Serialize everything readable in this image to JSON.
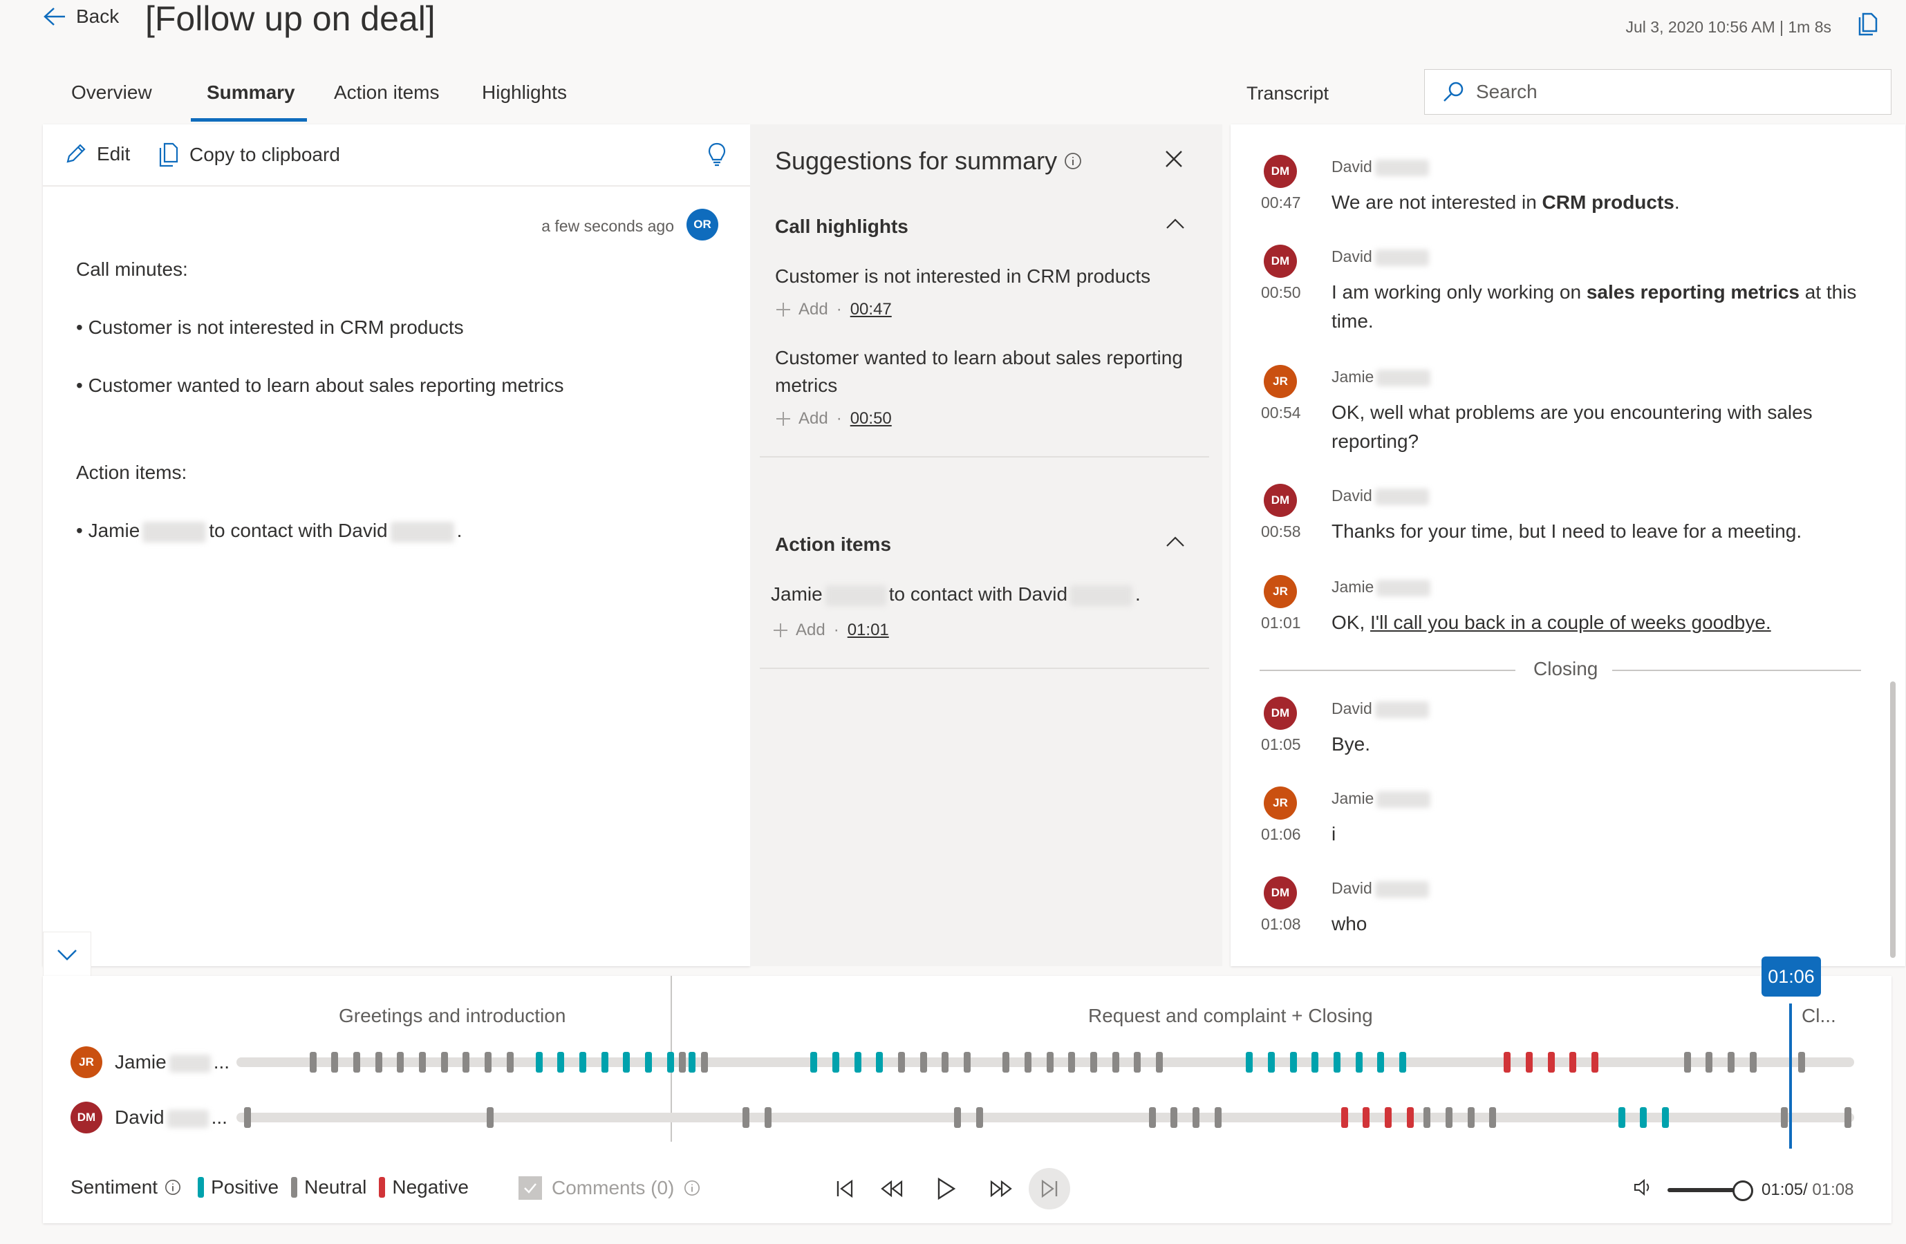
{
  "header": {
    "back_label": "Back",
    "title": "[Follow up on deal]",
    "meta": "Jul 3, 2020 10:56 AM | 1m 8s"
  },
  "tabs": [
    "Overview",
    "Summary",
    "Action items",
    "Highlights"
  ],
  "active_tab": "Summary",
  "transcript_title": "Transcript",
  "search": {
    "placeholder": "Search"
  },
  "summary": {
    "edit_label": "Edit",
    "copy_label": "Copy to clipboard",
    "updated": "a few seconds ago",
    "author_initials": "OR",
    "heading_minutes": "Call minutes:",
    "minutes": [
      "• Customer is not interested in CRM products",
      "• Customer wanted to learn about sales reporting metrics"
    ],
    "heading_actions": "Action items:",
    "action_prefix": "• Jamie",
    "action_middle": "to contact with David",
    "action_suffix": "."
  },
  "suggestions": {
    "title": "Suggestions for summary",
    "add_label": "Add",
    "highlights_title": "Call highlights",
    "highlights": [
      {
        "text": "Customer is not interested in CRM products",
        "time": "00:47"
      },
      {
        "text": "Customer wanted to learn about sales reporting metrics",
        "time": "00:50"
      }
    ],
    "actions_title": "Action items",
    "action": {
      "prefix": "Jamie",
      "middle": "to contact with David",
      "suffix": ".",
      "time": "01:01"
    }
  },
  "transcript": [
    {
      "initials": "DM",
      "name": "David",
      "time": "00:47",
      "pre": "We are not interested in ",
      "bold": "CRM products",
      "post": "."
    },
    {
      "initials": "DM",
      "name": "David",
      "time": "00:50",
      "pre": "I am working only working on ",
      "bold": "sales reporting metrics",
      "post": " at this time."
    },
    {
      "initials": "JR",
      "name": "Jamie",
      "time": "00:54",
      "pre": "OK, well what problems are you encountering with sales reporting?",
      "bold": "",
      "post": ""
    },
    {
      "initials": "DM",
      "name": "David",
      "time": "00:58",
      "pre": "Thanks for your time, but I need to leave for a meeting.",
      "bold": "",
      "post": ""
    },
    {
      "initials": "JR",
      "name": "Jamie",
      "time": "01:01",
      "pre": "OK, ",
      "link": "I'll call you back in a couple of weeks goodbye.",
      "post": ""
    },
    {
      "initials": "DM",
      "name": "David",
      "time": "01:05",
      "pre": "Bye.",
      "bold": "",
      "post": ""
    },
    {
      "initials": "JR",
      "name": "Jamie",
      "time": "01:06",
      "pre": "i",
      "bold": "",
      "post": ""
    },
    {
      "initials": "DM",
      "name": "David",
      "time": "01:08",
      "pre": "who",
      "bold": "",
      "post": ""
    }
  ],
  "closing_label": "Closing",
  "timeline": {
    "segments": [
      "Greetings and introduction",
      "Request and complaint + Closing",
      "Cl..."
    ],
    "tracks": [
      {
        "initials": "JR",
        "name": "Jamie",
        "ellipsis": "..."
      },
      {
        "initials": "DM",
        "name": "David",
        "ellipsis": "..."
      }
    ],
    "playhead": "01:06",
    "sentiment_label": "Sentiment",
    "legend": {
      "positive": "Positive",
      "neutral": "Neutral",
      "negative": "Negative"
    },
    "colors": {
      "positive": "#00a2ad",
      "neutral": "#8a8886",
      "negative": "#d13438"
    },
    "comments_label": "Comments (0)",
    "time_current": "01:05/",
    "time_total": "01:08"
  }
}
